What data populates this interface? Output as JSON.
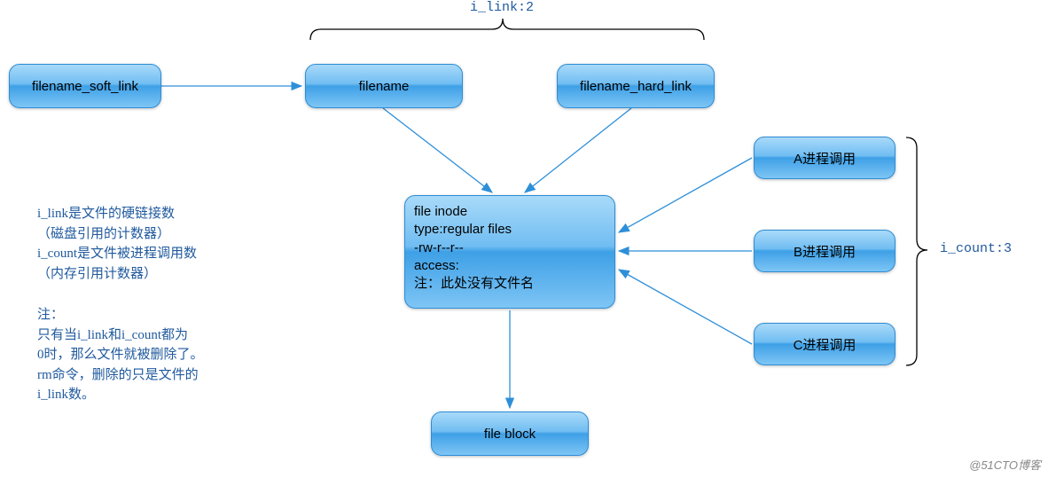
{
  "labels": {
    "i_link": "i_link:2",
    "i_count": "i_count:3"
  },
  "nodes": {
    "soft_link": "filename_soft_link",
    "filename": "filename",
    "hard_link": "filename_hard_link",
    "inode_l1": "file inode",
    "inode_l2": "type:regular files",
    "inode_l3": "-rw-r--r--",
    "inode_l4": "access:",
    "inode_l5": "注：此处没有文件名",
    "procA": "A进程调用",
    "procB": "B进程调用",
    "procC": "C进程调用",
    "block": "file block"
  },
  "notes": {
    "p1a": "i_link是文件的硬链接数",
    "p1b": "（磁盘引用的计数器）",
    "p1c": "i_count是文件被进程调用数",
    "p1d": "（内存引用计数器）",
    "p2a": "注：",
    "p2b": "只有当i_link和i_count都为",
    "p2c": "0时，那么文件就被删除了。",
    "p2d": "rm命令，删除的只是文件的",
    "p2e": "i_link数。"
  },
  "watermark": "@51CTO博客",
  "chart_data": {
    "type": "diagram",
    "title": "inode / hardlink / softlink / process reference diagram",
    "nodes": [
      {
        "id": "soft_link",
        "label": "filename_soft_link"
      },
      {
        "id": "filename",
        "label": "filename"
      },
      {
        "id": "hard_link",
        "label": "filename_hard_link"
      },
      {
        "id": "inode",
        "label": "file inode",
        "detail": [
          "type:regular files",
          "-rw-r--r--",
          "access:",
          "注：此处没有文件名"
        ]
      },
      {
        "id": "procA",
        "label": "A进程调用"
      },
      {
        "id": "procB",
        "label": "B进程调用"
      },
      {
        "id": "procC",
        "label": "C进程调用"
      },
      {
        "id": "block",
        "label": "file block"
      }
    ],
    "edges": [
      {
        "from": "soft_link",
        "to": "filename"
      },
      {
        "from": "filename",
        "to": "inode"
      },
      {
        "from": "hard_link",
        "to": "inode"
      },
      {
        "from": "procA",
        "to": "inode"
      },
      {
        "from": "procB",
        "to": "inode"
      },
      {
        "from": "procC",
        "to": "inode"
      },
      {
        "from": "inode",
        "to": "block"
      }
    ],
    "groups": [
      {
        "label": "i_link:2",
        "members": [
          "filename",
          "hard_link"
        ],
        "count": 2
      },
      {
        "label": "i_count:3",
        "members": [
          "procA",
          "procB",
          "procC"
        ],
        "count": 3
      }
    ],
    "annotations": [
      "i_link是文件的硬链接数（磁盘引用的计数器）",
      "i_count是文件被进程调用数（内存引用计数器）",
      "注：只有当i_link和i_count都为0时，那么文件就被删除了。rm命令，删除的只是文件的i_link数。"
    ]
  }
}
